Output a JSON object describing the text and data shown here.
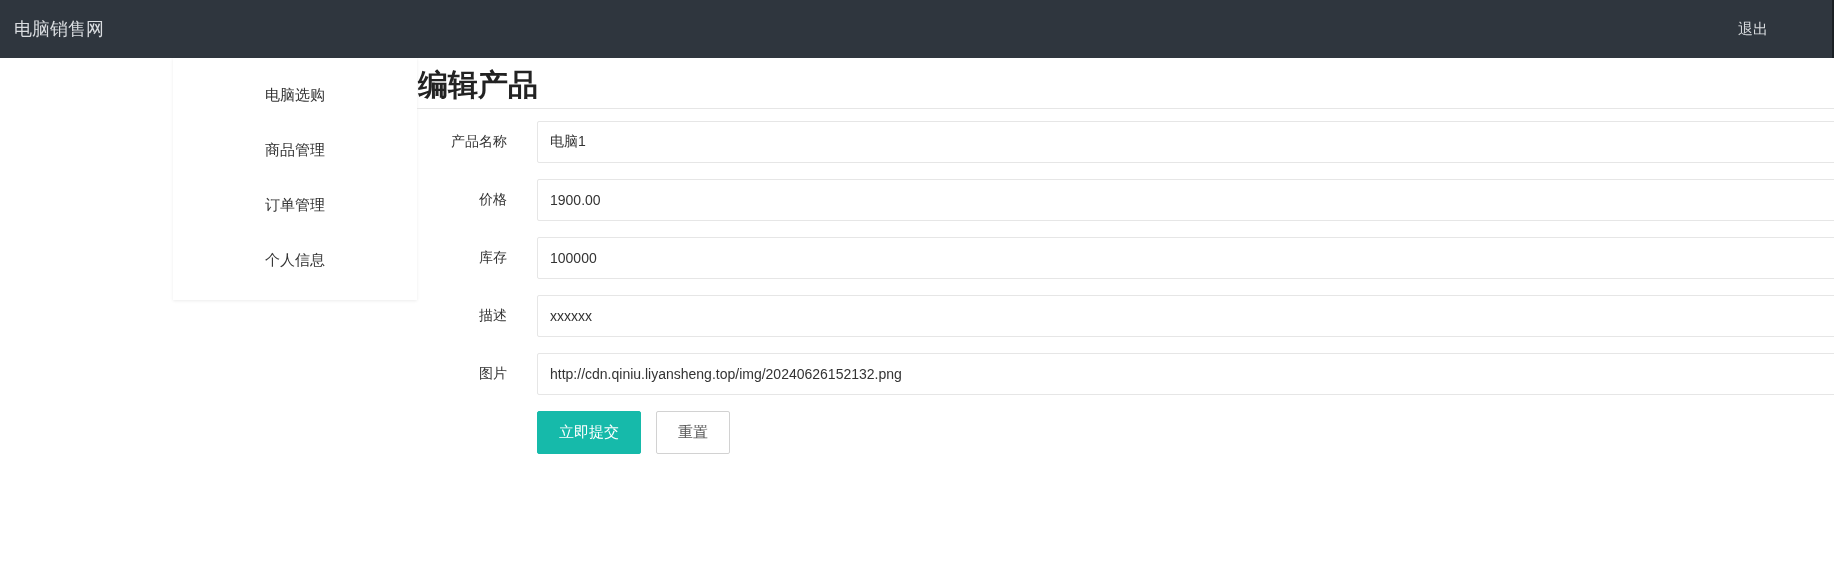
{
  "header": {
    "brand": "电脑销售网",
    "logout": "退出"
  },
  "sidebar": {
    "items": [
      {
        "label": "电脑选购"
      },
      {
        "label": "商品管理"
      },
      {
        "label": "订单管理"
      },
      {
        "label": "个人信息"
      }
    ]
  },
  "form": {
    "title": "编辑产品",
    "fields": [
      {
        "label": "产品名称",
        "value": "电脑1"
      },
      {
        "label": "价格",
        "value": "1900.00"
      },
      {
        "label": "库存",
        "value": "100000"
      },
      {
        "label": "描述",
        "value": "xxxxxx"
      },
      {
        "label": "图片",
        "value": "http://cdn.qiniu.liyansheng.top/img/20240626152132.png"
      }
    ],
    "buttons": [
      {
        "label": "立即提交",
        "kind": "primary"
      },
      {
        "label": "重置",
        "kind": "secondary"
      }
    ]
  }
}
